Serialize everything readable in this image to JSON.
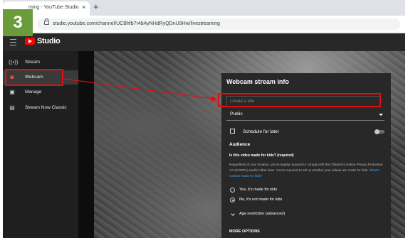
{
  "step_badge": "3",
  "browser": {
    "tab_title": "ming - YouTube Studio",
    "tab_close": "×",
    "new_tab": "+",
    "url": "studio.youtube.com/channel/UCBhfb7r4bAyNHdRyQDnU9Hw/livestreaming"
  },
  "header": {
    "logo_text": "Studio"
  },
  "sidebar": {
    "items": [
      {
        "label": "Stream",
        "icon": "((•))"
      },
      {
        "label": "Webcam",
        "icon": "◙"
      },
      {
        "label": "Manage",
        "icon": "▣"
      },
      {
        "label": "Stream Now Classic",
        "icon": "▤"
      }
    ]
  },
  "panel": {
    "title": "Webcam stream info",
    "title_placeholder": "Create a title",
    "privacy": "Public",
    "schedule_label": "Schedule for later",
    "audience_heading": "Audience",
    "audience_question": "Is this video made for kids? (required)",
    "audience_desc": "Regardless of your location, you're legally required to comply with the Children's Online Privacy Protection Act (COPPA) and/or other laws. You're required to tell us whether your videos are made for kids.",
    "audience_link": "What's content made for kids?",
    "radio_yes": "Yes, it's made for kids",
    "radio_no": "No, it's not made for kids",
    "age_restriction": "Age restriction (advanced)",
    "more_options": "MORE OPTIONS"
  },
  "colors": {
    "highlight": "#e11010",
    "badge": "#6a9c3c",
    "youtube_red": "#ff0000"
  }
}
